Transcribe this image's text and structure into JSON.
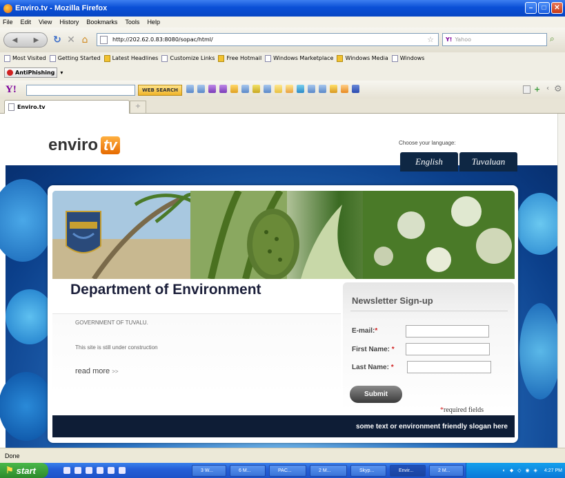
{
  "window": {
    "title": "Enviro.tv - Mozilla Firefox"
  },
  "menu": {
    "items": [
      "File",
      "Edit",
      "View",
      "History",
      "Bookmarks",
      "Tools",
      "Help"
    ]
  },
  "nav": {
    "url": "http://202.62.0.83:8080/sopac/html/",
    "search_placeholder": "Yahoo"
  },
  "bookmarks": {
    "items": [
      "Most Visited",
      "Getting Started",
      "Latest Headlines",
      "Customize Links",
      "Free Hotmail",
      "Windows Marketplace",
      "Windows Media",
      "Windows"
    ]
  },
  "antiphishing": {
    "label": "AntiPhishing"
  },
  "yahoo_toolbar": {
    "search_button": "WEB SEARCH"
  },
  "tabs": [
    {
      "label": "Enviro.tv"
    }
  ],
  "site": {
    "logo_text": "enviro",
    "logo_tv": "tv",
    "language_label": "Choose your language:",
    "languages": [
      "English",
      "Tuvaluan"
    ],
    "title": "Department of Environment",
    "gov_text": "GOVERNMENT OF TUVALU.",
    "construction_text": "This site is still under construction",
    "read_more": "read more",
    "read_more_arrow": ">>",
    "newsletter": {
      "title": "Newsletter Sign-up",
      "email_label": "E-mail:",
      "first_name_label": "First Name:",
      "last_name_label": "Last Name:",
      "required_mark": "*",
      "submit": "Submit",
      "required_note": "required fields"
    },
    "footer_slogan": "some text or environment friendly slogan here"
  },
  "status": {
    "text": "Done"
  },
  "taskbar": {
    "start": "start",
    "tasks": [
      "3 W...",
      "6 M...",
      "PAC...",
      "2 M...",
      "Skyp...",
      "Envir...",
      "2 M..."
    ],
    "clock": "4:27 PM"
  },
  "colors": {
    "accent_navy": "#0e1d36",
    "logo_orange": "#e66a00",
    "ocean_blue": "#2a72c2"
  }
}
